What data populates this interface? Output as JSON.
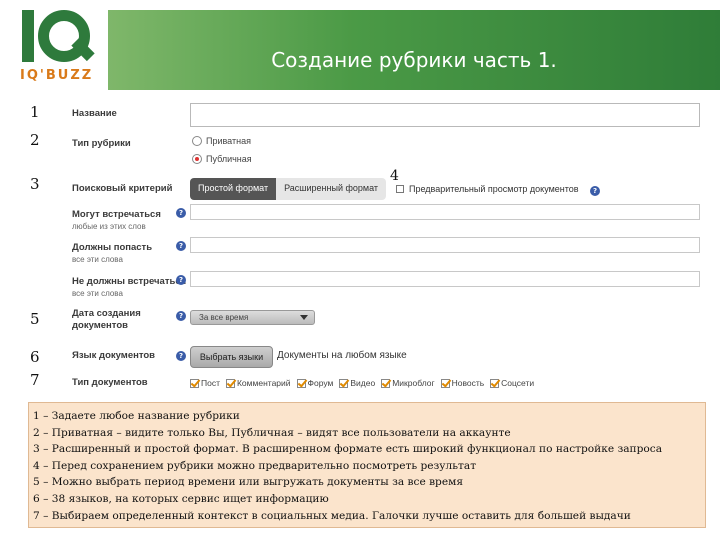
{
  "header": {
    "logo_text": "IQ'BUZZ",
    "title": "Создание рубрики часть 1."
  },
  "markers": [
    "1",
    "2",
    "3",
    "4",
    "5",
    "6",
    "7"
  ],
  "form": {
    "name_label": "Название",
    "rubric_type_label": "Тип рубрики",
    "rubric_type_options": [
      "Приватная",
      "Публичная"
    ],
    "rubric_type_selected": "Публичная",
    "search_criteria_label": "Поисковый критерий",
    "tabs": [
      "Простой формат",
      "Расширенный формат"
    ],
    "active_tab": "Простой формат",
    "preview_label": "Предварительный просмотр документов",
    "may_meet_label": "Могут встречаться",
    "may_meet_hint": "любые из этих слов",
    "must_have_label": "Должны попасть",
    "must_have_hint": "все эти слова",
    "must_not_label": "Не должны встречаться",
    "must_not_hint": "все эти слова",
    "date_label": "Дата создания документов",
    "date_value": "За все время",
    "language_label": "Язык документов",
    "language_button": "Выбрать языки",
    "language_value": "Документы на любом языке",
    "doc_types_label": "Тип документов",
    "doc_types": [
      "Пост",
      "Комментарий",
      "Форум",
      "Видео",
      "Микроблог",
      "Новость",
      "Соцсети"
    ]
  },
  "colors": {
    "brand_green": "#2e7a3c",
    "logo_orange": "#d97a1a",
    "notes_bg": "#fbe4cc",
    "help_icon": "#3a5ca8"
  },
  "notes": [
    "1 – Задаете любое название рубрики",
    "2 – Приватная – видите только Вы, Публичная – видят все пользователи на аккаунте",
    "3 – Расширенный и простой формат. В расширенном формате есть широкий функционал по настройке запроса",
    "4 – Перед сохранением рубрики можно предварительно посмотреть результат",
    "5 – Можно выбрать период времени или выгружать документы за все время",
    "6 – 38 языков, на которых сервис ищет информацию",
    "7 – Выбираем определенный контекст в социальных медиа. Галочки лучше оставить для большей выдачи"
  ]
}
